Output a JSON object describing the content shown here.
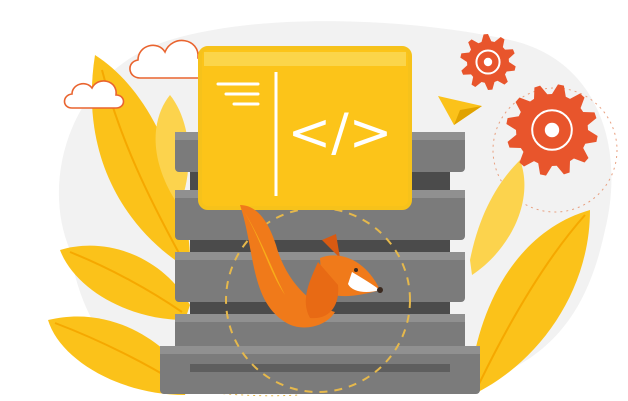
{
  "illustration": {
    "code_symbol": "</>",
    "icons": [
      "cloud-icon",
      "gear-icon",
      "paper-plane-icon",
      "fox-icon",
      "code-window-icon",
      "server-rack-icon",
      "leaf-icon"
    ]
  },
  "colors": {
    "background_blob": "#f2f2f2",
    "leaf_yellow": "#fbc21a",
    "leaf_light": "#fcd34d",
    "window_yellow": "#fcc419",
    "window_border": "#f6c21b",
    "window_code": "#ffffff",
    "server_gray": "#7b7b7b",
    "server_dark": "#5f5f5f",
    "server_slot": "#4b4b4b",
    "gear_red": "#e8552c",
    "cloud_red": "#e9642f",
    "fox_orange": "#f07a1a",
    "fox_dark": "#d85a12",
    "plane_yellow": "#fbc21a",
    "dash_gold": "#e5b84c"
  }
}
